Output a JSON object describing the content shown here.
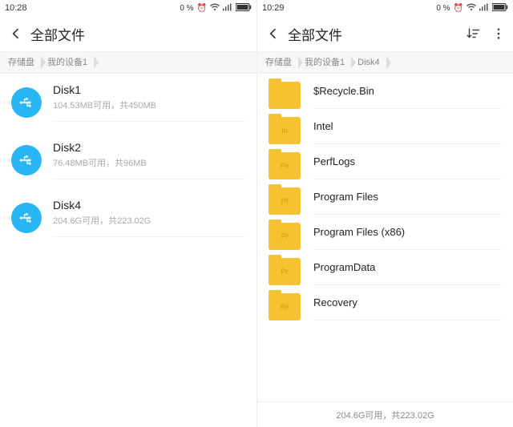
{
  "left": {
    "status": {
      "time": "10:28",
      "pct": "0 %"
    },
    "title": "全部文件",
    "breadcrumb": [
      "存储盘",
      "我的设备1"
    ],
    "disks": [
      {
        "name": "Disk1",
        "sub": "104.53MB可用，共450MB"
      },
      {
        "name": "Disk2",
        "sub": "76.48MB可用，共96MB"
      },
      {
        "name": "Disk4",
        "sub": "204.6G可用，共223.02G"
      }
    ]
  },
  "right": {
    "status": {
      "time": "10:29",
      "pct": "0 %"
    },
    "title": "全部文件",
    "breadcrumb": [
      "存储盘",
      "我的设备1",
      "Disk4"
    ],
    "folders": [
      {
        "short": "",
        "name": "$Recycle.Bin"
      },
      {
        "short": "In",
        "name": "Intel"
      },
      {
        "short": "Pe",
        "name": "PerfLogs"
      },
      {
        "short": "Pf",
        "name": "Program Files"
      },
      {
        "short": "Pf",
        "name": "Program Files (x86)"
      },
      {
        "short": "Pr",
        "name": "ProgramData"
      },
      {
        "short": "Re",
        "name": "Recovery"
      }
    ],
    "bottom": "204.6G可用，共223.02G"
  }
}
